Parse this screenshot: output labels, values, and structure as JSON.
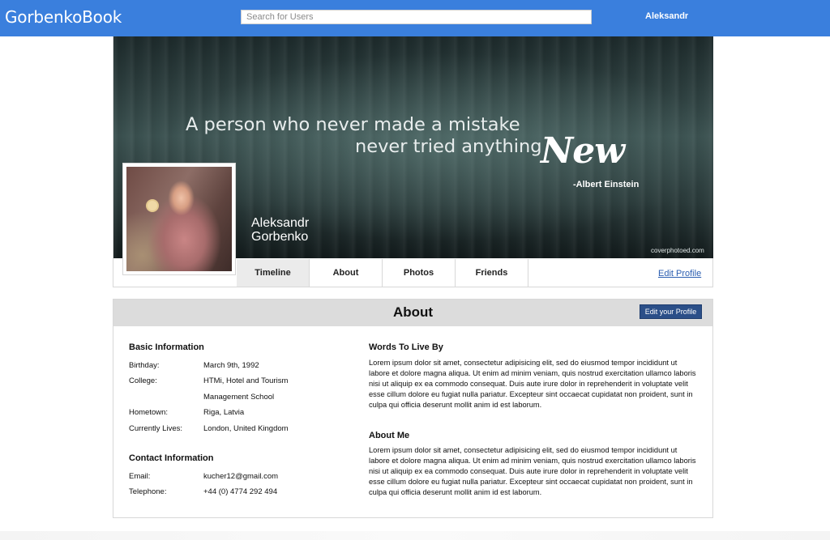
{
  "header": {
    "brand": "GorbenkoBook",
    "search_placeholder": "Search for Users",
    "username": "Aleksandr"
  },
  "cover": {
    "quote_line1": "A person who never made a mistake",
    "quote_line2": "never tried anything",
    "quote_emphasis": "New",
    "quote_author": "-Albert Einstein",
    "watermark": "coverphotoed.com",
    "first_name": "Aleksandr",
    "last_name": "Gorbenko"
  },
  "tabs": [
    {
      "label": "Timeline",
      "active": true
    },
    {
      "label": "About",
      "active": false
    },
    {
      "label": "Photos",
      "active": false
    },
    {
      "label": "Friends",
      "active": false
    }
  ],
  "edit_profile_link": "Edit Profile",
  "about": {
    "title": "About",
    "edit_button": "Edit your Profile",
    "basic_info": {
      "heading": "Basic Information",
      "birthday_label": "Birthday:",
      "birthday_value": "March 9th, 1992",
      "college_label": "College:",
      "college_value_line1": "HTMi, Hotel and Tourism",
      "college_value_line2": "Management School",
      "hometown_label": "Hometown:",
      "hometown_value": "Riga, Latvia",
      "currently_label": "Currently Lives:",
      "currently_value": "London, United Kingdom"
    },
    "contact_info": {
      "heading": "Contact Information",
      "email_label": "Email:",
      "email_value": "kucher12@gmail.com",
      "telephone_label": "Telephone:",
      "telephone_value": "+44 (0) 4774 292 494"
    },
    "words_to_live_by": {
      "heading": "Words To Live By",
      "text": "Lorem ipsum dolor sit amet, consectetur adipisicing elit, sed do eiusmod tempor incididunt ut labore et dolore magna aliqua. Ut enim ad minim veniam, quis nostrud exercitation ullamco laboris nisi ut aliquip ex ea commodo consequat. Duis aute irure dolor in reprehenderit in voluptate velit esse cillum dolore eu fugiat nulla pariatur. Excepteur sint occaecat cupidatat non proident, sunt in culpa qui officia deserunt mollit anim id est laborum."
    },
    "about_me": {
      "heading": "About Me",
      "text": "Lorem ipsum dolor sit amet, consectetur adipisicing elit, sed do eiusmod tempor incididunt ut labore et dolore magna aliqua. Ut enim ad minim veniam, quis nostrud exercitation ullamco laboris nisi ut aliquip ex ea commodo consequat. Duis aute irure dolor in reprehenderit in voluptate velit esse cillum dolore eu fugiat nulla pariatur. Excepteur sint occaecat cupidatat non proident, sunt in culpa qui officia deserunt mollit anim id est laborum."
    }
  }
}
